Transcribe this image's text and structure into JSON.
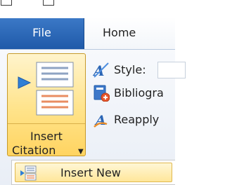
{
  "tabs": {
    "file_label": "File",
    "home_label": "Home"
  },
  "citations": {
    "insert_citation_line1": "Insert",
    "insert_citation_line2": "Citation",
    "style_label": "Style:",
    "bibliography_label": "Bibliogra",
    "reapply_label": "Reapply"
  },
  "dropdown": {
    "insert_new_label": "Insert New"
  },
  "icons": {
    "insert_citation": "insert-citation-icon",
    "style": "style-icon",
    "bibliography": "bibliography-icon",
    "reapply": "reapply-icon",
    "insert_new": "insert-new-icon",
    "dropdown_arrow": "chevron-down-icon"
  },
  "colors": {
    "file_tab": "#2b66b5",
    "highlight": "#ffe38a",
    "highlight_border": "#c69a2b"
  }
}
